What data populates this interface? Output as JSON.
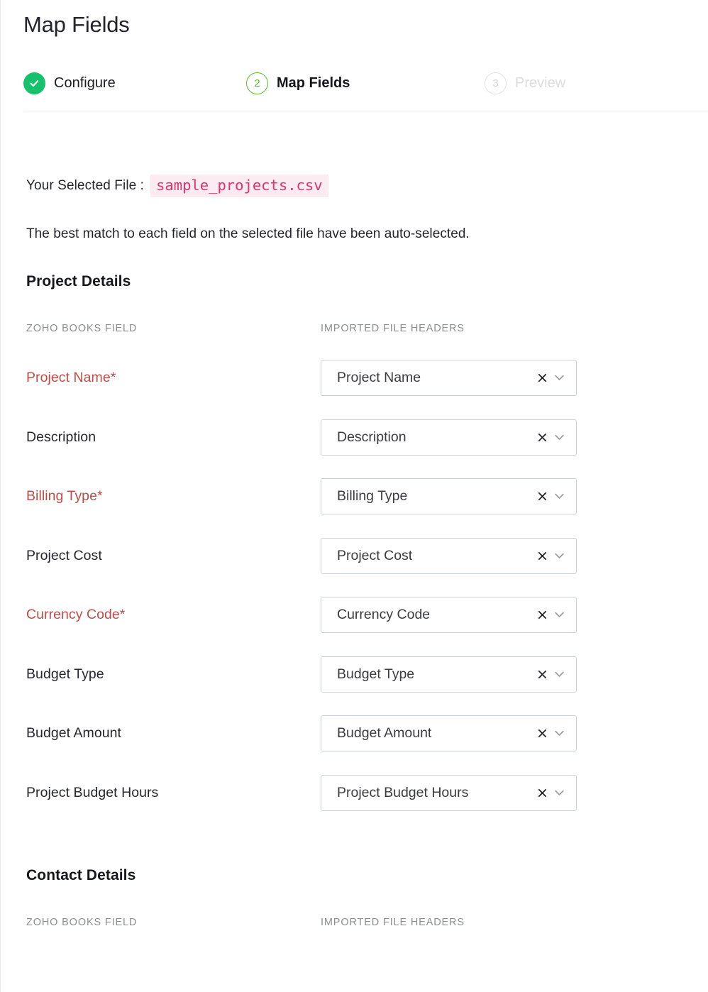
{
  "header": {
    "title": "Map Fields",
    "steps": [
      {
        "state": "done",
        "badge": "check-icon",
        "label": "Configure"
      },
      {
        "state": "current",
        "badge": "2",
        "label": "Map Fields"
      },
      {
        "state": "upcoming",
        "badge": "3",
        "label": "Preview"
      }
    ]
  },
  "main": {
    "selected_file_label": "Your Selected File :",
    "selected_file_name": "sample_projects.csv",
    "helper_text": "The best match to each field on the selected file have been auto-selected.",
    "column_headers": {
      "zoho": "ZOHO BOOKS FIELD",
      "imported": "IMPORTED FILE HEADERS"
    },
    "sections": [
      {
        "title": "Project Details",
        "rows": [
          {
            "label": "Project Name*",
            "required": true,
            "value": "Project Name"
          },
          {
            "label": "Description",
            "required": false,
            "value": "Description"
          },
          {
            "label": "Billing Type*",
            "required": true,
            "value": "Billing Type"
          },
          {
            "label": "Project Cost",
            "required": false,
            "value": "Project Cost"
          },
          {
            "label": "Currency Code*",
            "required": true,
            "value": "Currency Code"
          },
          {
            "label": "Budget Type",
            "required": false,
            "value": "Budget Type"
          },
          {
            "label": "Budget Amount",
            "required": false,
            "value": "Budget Amount"
          },
          {
            "label": "Project Budget Hours",
            "required": false,
            "value": "Project Budget Hours"
          }
        ]
      },
      {
        "title": "Contact Details",
        "rows": []
      }
    ]
  },
  "icons": {
    "clear": "close-icon",
    "dropdown": "chevron-down-icon",
    "step_done": "check-icon"
  },
  "colors": {
    "step_done_bg": "#15c26b",
    "step_current": "#5bbd2a",
    "step_upcoming": "#dcdcdc",
    "required_label": "#bf4c45",
    "file_name_text": "#e0336e",
    "file_name_bg": "#fcecf2",
    "select_border": "#ccd1d7"
  }
}
